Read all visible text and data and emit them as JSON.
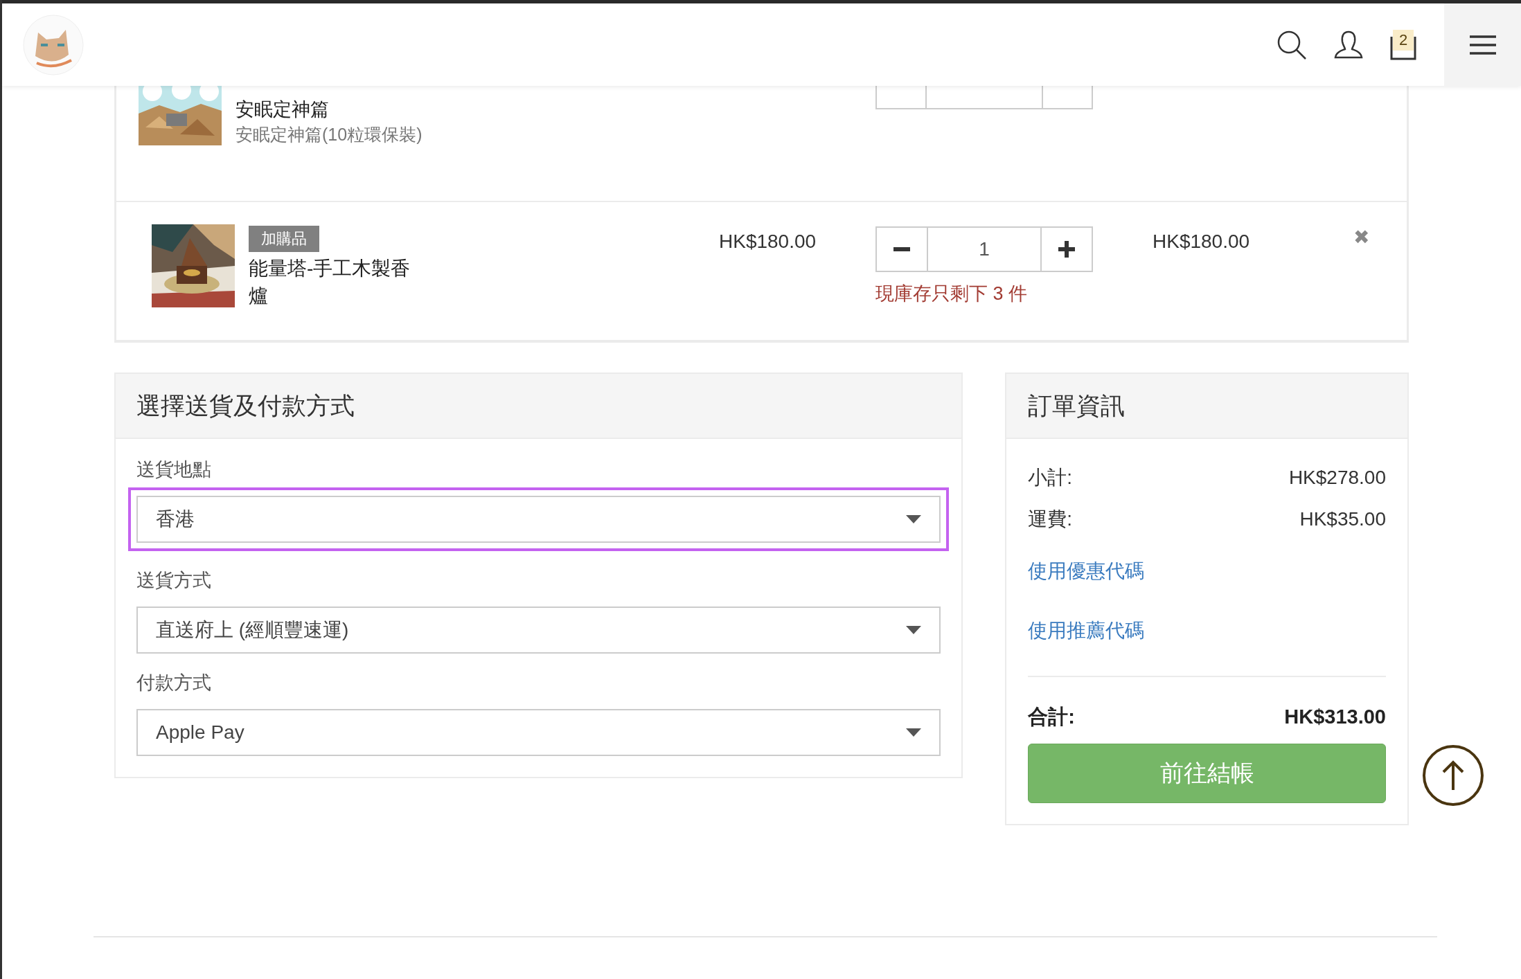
{
  "header": {
    "cart_count": "2"
  },
  "cart_items": [
    {
      "kind": "partial",
      "name": "安眠定神篇",
      "variant": "安眠定神篇(10粒環保裝)"
    },
    {
      "kind": "full",
      "badge": "加購品",
      "name": "能量塔-手工木製香爐",
      "price": "HK$180.00",
      "quantity": "1",
      "stock_note": "現庫存只剩下 3 件",
      "total": "HK$180.00",
      "remove": "✖"
    }
  ],
  "delivery_panel": {
    "title": "選擇送貨及付款方式",
    "fields": [
      {
        "label": "送貨地點",
        "value": "香港",
        "focused": true
      },
      {
        "label": "送貨方式",
        "value": "直送府上 (經順豐速運)",
        "focused": false
      },
      {
        "label": "付款方式",
        "value": "Apple Pay",
        "focused": false
      }
    ]
  },
  "order_panel": {
    "title": "訂單資訊",
    "lines": [
      {
        "label": "小計:",
        "value": "HK$278.00"
      },
      {
        "label": "運費:",
        "value": "HK$35.00"
      }
    ],
    "links": [
      "使用優惠代碼",
      "使用推薦代碼"
    ],
    "total_label": "合計:",
    "total_value": "HK$313.00",
    "checkout": "前往結帳"
  }
}
